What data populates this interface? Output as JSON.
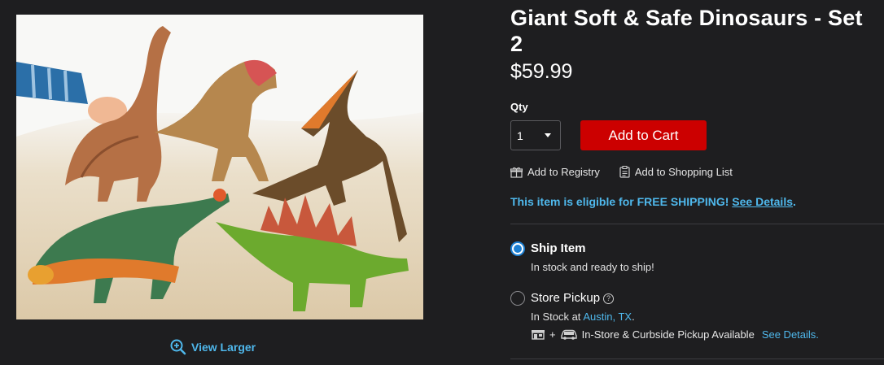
{
  "product": {
    "title": "Giant Soft & Safe Dinosaurs - Set 2",
    "price": "$59.99",
    "image_alt": "Five soft dinosaur toys in sand",
    "view_larger": "View Larger"
  },
  "purchase": {
    "qty_label": "Qty",
    "qty_value": "1",
    "add_to_cart": "Add to Cart",
    "add_to_registry": "Add to Registry",
    "add_to_list": "Add to Shopping List"
  },
  "shipping": {
    "message": "This item is eligible for FREE SHIPPING!",
    "details_link": "See Details",
    "period": "."
  },
  "fulfillment": {
    "ship": {
      "label": "Ship Item",
      "status": "In stock and ready to ship!",
      "selected": true
    },
    "pickup": {
      "label": "Store Pickup",
      "help": "?",
      "stock_prefix": "In Stock at",
      "store": "Austin, TX",
      "period": ".",
      "plus": "+",
      "availability": "In-Store & Curbside Pickup Available",
      "details_link": "See Details.",
      "selected": false
    }
  },
  "colors": {
    "background": "#1e1e20",
    "accent_blue": "#4fb8ec",
    "cart_red": "#cc0000",
    "radio_blue": "#1c7fd2"
  }
}
